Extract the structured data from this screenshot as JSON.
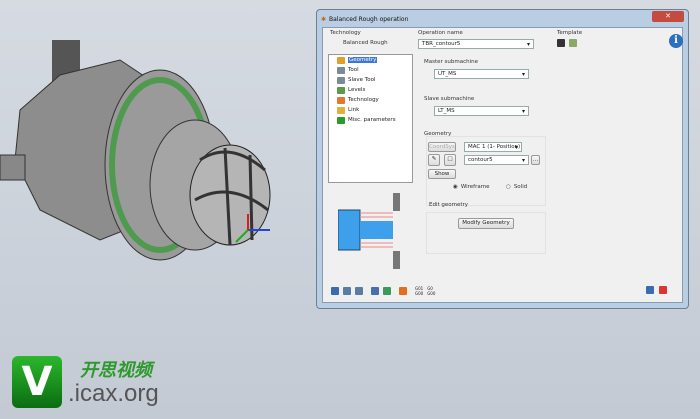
{
  "dialog": {
    "title": "Balanced Rough operation",
    "technology_label": "Technology",
    "technology_value": "Balanced Rough",
    "operation_name_label": "Operation name",
    "operation_name_value": "TBR_contour5",
    "template_label": "Template",
    "tree": [
      {
        "label": "Geometry",
        "icon": "geometry-icon",
        "color": "#e0a030",
        "selected": true
      },
      {
        "label": "Tool",
        "icon": "tool-icon",
        "color": "#7a8a9a"
      },
      {
        "label": "Slave Tool",
        "icon": "slave-tool-icon",
        "color": "#7a8a9a"
      },
      {
        "label": "Levels",
        "icon": "levels-icon",
        "color": "#5a9a4a"
      },
      {
        "label": "Technology",
        "icon": "technology-icon",
        "color": "#e07a30"
      },
      {
        "label": "Link",
        "icon": "link-icon",
        "color": "#e0b040"
      },
      {
        "label": "Misc. parameters",
        "icon": "plus-icon",
        "color": "#2a9a2a"
      }
    ],
    "master_label": "Master submachine",
    "master_value": "UT_MS",
    "slave_label": "Slave submachine",
    "slave_value": "LT_MS",
    "geometry_label": "Geometry",
    "coordsys_label": "CoordSys",
    "mac_value": "MAC 1 (1- Position)",
    "contour_value": "contour5",
    "browse_label": "...",
    "show_label": "Show",
    "wireframe_label": "Wireframe",
    "solid_label": "Solid",
    "display_mode": "Wireframe",
    "edit_geometry_label": "Edit geometry",
    "modify_geometry_label": "Modify Geometry"
  },
  "watermark": {
    "logo_letter": "V",
    "cn_text": "开思视频",
    "site": ".icax.org"
  },
  "colors": {
    "accent": "#3a78d4",
    "part_green": "#4f9a4f",
    "logo_green": "#2e9a2e"
  }
}
